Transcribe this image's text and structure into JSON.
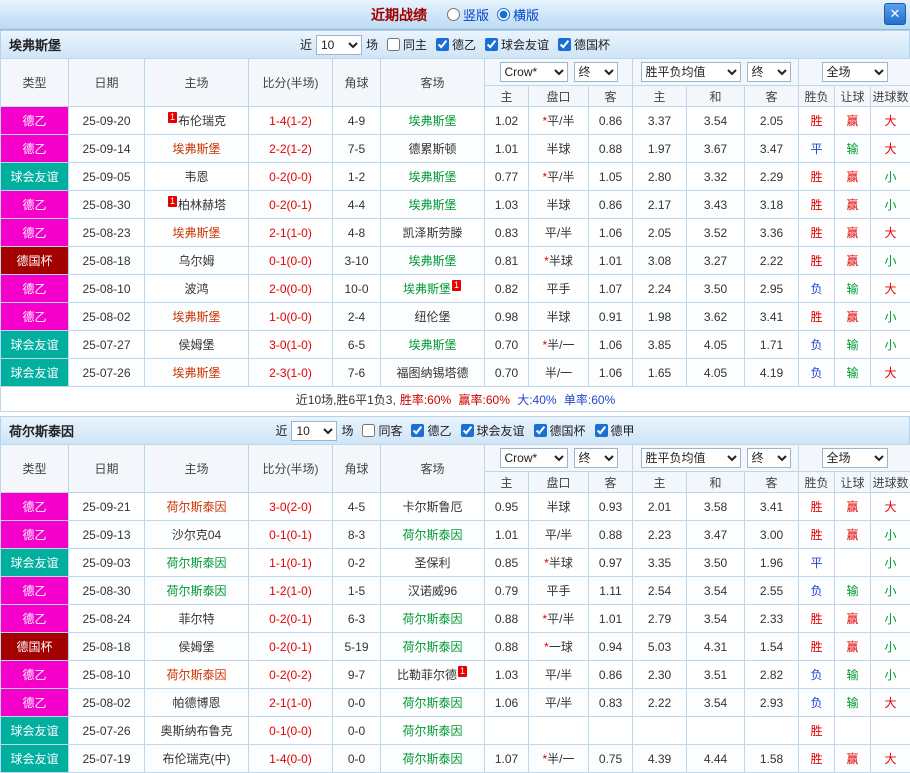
{
  "titlebar": {
    "title": "近期战绩",
    "vertical_label": "竖版",
    "horizontal_label": "横版",
    "close_label": "✕"
  },
  "table_header": {
    "type": "类型",
    "date": "日期",
    "home": "主场",
    "score": "比分(半场)",
    "corner": "角球",
    "away": "客场",
    "bookmaker": "Crow*",
    "odds_stage": "终",
    "avg": "胜平负均值",
    "avg_stage": "终",
    "scope": "全场",
    "sub": [
      "主",
      "盘口",
      "客",
      "主",
      "和",
      "客",
      "胜负",
      "让球",
      "进球数"
    ]
  },
  "type_colors": {
    "德乙": "#f500cb",
    "球会友谊": "#00af9e",
    "德国杯": "#a30000"
  },
  "team_colors": {
    "red": "#cc3300",
    "green": "#009933",
    "black": "#333333"
  },
  "result_colors": {
    "胜": "#e60000",
    "平": "#2244cc",
    "负": "#2244cc",
    "赢": "#e60000",
    "输": "#009933",
    "大": "#e60000",
    "小": "#009933"
  },
  "sections": [
    {
      "team": "埃弗斯堡",
      "filters": {
        "near": "近",
        "count": "10",
        "games": "场",
        "checkboxes": [
          {
            "label": "同主",
            "checked": false
          },
          {
            "label": "德乙",
            "checked": true
          },
          {
            "label": "球会友谊",
            "checked": true
          },
          {
            "label": "德国杯",
            "checked": true
          }
        ]
      },
      "rows": [
        {
          "type": "德乙",
          "date": "25-09-20",
          "home": "布伦瑞克",
          "home_color": "black",
          "home_badge": "1",
          "home_badge_pos": "before",
          "score": "1-4(1-2)",
          "corner": "4-9",
          "away": "埃弗斯堡",
          "away_color": "green",
          "odds": [
            "1.02",
            "*平/半",
            "0.86"
          ],
          "avg": [
            "3.37",
            "3.54",
            "2.05"
          ],
          "res": [
            "胜",
            "赢",
            "大"
          ]
        },
        {
          "type": "德乙",
          "date": "25-09-14",
          "home": "埃弗斯堡",
          "home_color": "red",
          "score": "2-2(1-2)",
          "corner": "7-5",
          "away": "德累斯顿",
          "away_color": "black",
          "odds": [
            "1.01",
            "半球",
            "0.88"
          ],
          "avg": [
            "1.97",
            "3.67",
            "3.47"
          ],
          "res": [
            "平",
            "输",
            "大"
          ]
        },
        {
          "type": "球会友谊",
          "date": "25-09-05",
          "home": "韦恩",
          "home_color": "black",
          "score": "0-2(0-0)",
          "corner": "1-2",
          "away": "埃弗斯堡",
          "away_color": "green",
          "odds": [
            "0.77",
            "*平/半",
            "1.05"
          ],
          "avg": [
            "2.80",
            "3.32",
            "2.29"
          ],
          "res": [
            "胜",
            "赢",
            "小"
          ]
        },
        {
          "type": "德乙",
          "date": "25-08-30",
          "home": "柏林赫塔",
          "home_color": "black",
          "home_badge": "1",
          "home_badge_pos": "before",
          "score": "0-2(0-1)",
          "corner": "4-4",
          "away": "埃弗斯堡",
          "away_color": "green",
          "odds": [
            "1.03",
            "半球",
            "0.86"
          ],
          "avg": [
            "2.17",
            "3.43",
            "3.18"
          ],
          "res": [
            "胜",
            "赢",
            "小"
          ]
        },
        {
          "type": "德乙",
          "date": "25-08-23",
          "home": "埃弗斯堡",
          "home_color": "red",
          "score": "2-1(1-0)",
          "corner": "4-8",
          "away": "凯泽斯劳滕",
          "away_color": "black",
          "odds": [
            "0.83",
            "平/半",
            "1.06"
          ],
          "avg": [
            "2.05",
            "3.52",
            "3.36"
          ],
          "res": [
            "胜",
            "赢",
            "大"
          ]
        },
        {
          "type": "德国杯",
          "date": "25-08-18",
          "home": "乌尔姆",
          "home_color": "black",
          "score": "0-1(0-0)",
          "corner": "3-10",
          "away": "埃弗斯堡",
          "away_color": "green",
          "odds": [
            "0.81",
            "*半球",
            "1.01"
          ],
          "avg": [
            "3.08",
            "3.27",
            "2.22"
          ],
          "res": [
            "胜",
            "赢",
            "小"
          ]
        },
        {
          "type": "德乙",
          "date": "25-08-10",
          "home": "波鸿",
          "home_color": "black",
          "score": "2-0(0-0)",
          "corner": "10-0",
          "away": "埃弗斯堡",
          "away_color": "green",
          "away_badge": "1",
          "away_badge_pos": "after",
          "odds": [
            "0.82",
            "平手",
            "1.07"
          ],
          "avg": [
            "2.24",
            "3.50",
            "2.95"
          ],
          "res": [
            "负",
            "输",
            "大"
          ]
        },
        {
          "type": "德乙",
          "date": "25-08-02",
          "home": "埃弗斯堡",
          "home_color": "red",
          "score": "1-0(0-0)",
          "corner": "2-4",
          "away": "纽伦堡",
          "away_color": "black",
          "odds": [
            "0.98",
            "半球",
            "0.91"
          ],
          "avg": [
            "1.98",
            "3.62",
            "3.41"
          ],
          "res": [
            "胜",
            "赢",
            "小"
          ]
        },
        {
          "type": "球会友谊",
          "date": "25-07-27",
          "home": "侯姆堡",
          "home_color": "black",
          "score": "3-0(1-0)",
          "corner": "6-5",
          "away": "埃弗斯堡",
          "away_color": "green",
          "odds": [
            "0.70",
            "*半/一",
            "1.06"
          ],
          "avg": [
            "3.85",
            "4.05",
            "1.71"
          ],
          "res": [
            "负",
            "输",
            "小"
          ]
        },
        {
          "type": "球会友谊",
          "date": "25-07-26",
          "home": "埃弗斯堡",
          "home_color": "red",
          "score": "2-3(1-0)",
          "corner": "7-6",
          "away": "福图纳锡塔德",
          "away_color": "black",
          "odds": [
            "0.70",
            "半/一",
            "1.06"
          ],
          "avg": [
            "1.65",
            "4.05",
            "4.19"
          ],
          "res": [
            "负",
            "输",
            "大"
          ]
        }
      ],
      "summary": [
        {
          "text": "近10场,胜6平1负3,",
          "color": "#333333"
        },
        {
          "text": "胜率:60%",
          "color": "#cc0000"
        },
        {
          "text": " 赢率:60%",
          "color": "#cc0000"
        },
        {
          "text": " 大:40%",
          "color": "#2244cc"
        },
        {
          "text": " 单率:60%",
          "color": "#2244cc"
        }
      ]
    },
    {
      "team": "荷尔斯泰因",
      "filters": {
        "near": "近",
        "count": "10",
        "games": "场",
        "checkboxes": [
          {
            "label": "同客",
            "checked": false
          },
          {
            "label": "德乙",
            "checked": true
          },
          {
            "label": "球会友谊",
            "checked": true
          },
          {
            "label": "德国杯",
            "checked": true
          },
          {
            "label": "德甲",
            "checked": true
          }
        ]
      },
      "rows": [
        {
          "type": "德乙",
          "date": "25-09-21",
          "home": "荷尔斯泰因",
          "home_color": "red",
          "score": "3-0(2-0)",
          "corner": "4-5",
          "away": "卡尔斯鲁厄",
          "away_color": "black",
          "odds": [
            "0.95",
            "半球",
            "0.93"
          ],
          "avg": [
            "2.01",
            "3.58",
            "3.41"
          ],
          "res": [
            "胜",
            "赢",
            "大"
          ]
        },
        {
          "type": "德乙",
          "date": "25-09-13",
          "home": "沙尔克04",
          "home_color": "black",
          "score": "0-1(0-1)",
          "corner": "8-3",
          "away": "荷尔斯泰因",
          "away_color": "green",
          "odds": [
            "1.01",
            "平/半",
            "0.88"
          ],
          "avg": [
            "2.23",
            "3.47",
            "3.00"
          ],
          "res": [
            "胜",
            "赢",
            "小"
          ]
        },
        {
          "type": "球会友谊",
          "date": "25-09-03",
          "home": "荷尔斯泰因",
          "home_color": "green",
          "score": "1-1(0-1)",
          "corner": "0-2",
          "away": "圣保利",
          "away_color": "black",
          "odds": [
            "0.85",
            "*半球",
            "0.97"
          ],
          "avg": [
            "3.35",
            "3.50",
            "1.96"
          ],
          "res": [
            "平",
            "",
            "小"
          ]
        },
        {
          "type": "德乙",
          "date": "25-08-30",
          "home": "荷尔斯泰因",
          "home_color": "green",
          "score": "1-2(1-0)",
          "corner": "1-5",
          "away": "汉诺威96",
          "away_color": "black",
          "odds": [
            "0.79",
            "平手",
            "1.11"
          ],
          "avg": [
            "2.54",
            "3.54",
            "2.55"
          ],
          "res": [
            "负",
            "输",
            "小"
          ]
        },
        {
          "type": "德乙",
          "date": "25-08-24",
          "home": "菲尔特",
          "home_color": "black",
          "score": "0-2(0-1)",
          "corner": "6-3",
          "away": "荷尔斯泰因",
          "away_color": "green",
          "odds": [
            "0.88",
            "*平/半",
            "1.01"
          ],
          "avg": [
            "2.79",
            "3.54",
            "2.33"
          ],
          "res": [
            "胜",
            "赢",
            "小"
          ]
        },
        {
          "type": "德国杯",
          "date": "25-08-18",
          "home": "侯姆堡",
          "home_color": "black",
          "score": "0-2(0-1)",
          "corner": "5-19",
          "away": "荷尔斯泰因",
          "away_color": "green",
          "odds": [
            "0.88",
            "*一球",
            "0.94"
          ],
          "avg": [
            "5.03",
            "4.31",
            "1.54"
          ],
          "res": [
            "胜",
            "赢",
            "小"
          ]
        },
        {
          "type": "德乙",
          "date": "25-08-10",
          "home": "荷尔斯泰因",
          "home_color": "red",
          "score": "0-2(0-2)",
          "corner": "9-7",
          "away": "比勒菲尔德",
          "away_color": "black",
          "away_badge": "1",
          "away_badge_pos": "after",
          "odds": [
            "1.03",
            "平/半",
            "0.86"
          ],
          "avg": [
            "2.30",
            "3.51",
            "2.82"
          ],
          "res": [
            "负",
            "输",
            "小"
          ]
        },
        {
          "type": "德乙",
          "date": "25-08-02",
          "home": "帕德博恩",
          "home_color": "black",
          "score": "2-1(1-0)",
          "corner": "0-0",
          "away": "荷尔斯泰因",
          "away_color": "green",
          "odds": [
            "1.06",
            "平/半",
            "0.83"
          ],
          "avg": [
            "2.22",
            "3.54",
            "2.93"
          ],
          "res": [
            "负",
            "输",
            "大"
          ]
        },
        {
          "type": "球会友谊",
          "date": "25-07-26",
          "home": "奥斯纳布鲁克",
          "home_color": "black",
          "score": "0-1(0-0)",
          "corner": "0-0",
          "away": "荷尔斯泰因",
          "away_color": "green",
          "odds": [
            "",
            "",
            ""
          ],
          "avg": [
            "",
            "",
            ""
          ],
          "res": [
            "胜",
            "",
            ""
          ]
        },
        {
          "type": "球会友谊",
          "date": "25-07-19",
          "home": "布伦瑞克(中)",
          "home_color": "black",
          "score": "1-4(0-0)",
          "corner": "0-0",
          "away": "荷尔斯泰因",
          "away_color": "green",
          "odds": [
            "1.07",
            "*半/一",
            "0.75"
          ],
          "avg": [
            "4.39",
            "4.44",
            "1.58"
          ],
          "res": [
            "胜",
            "赢",
            "大"
          ]
        }
      ]
    }
  ]
}
